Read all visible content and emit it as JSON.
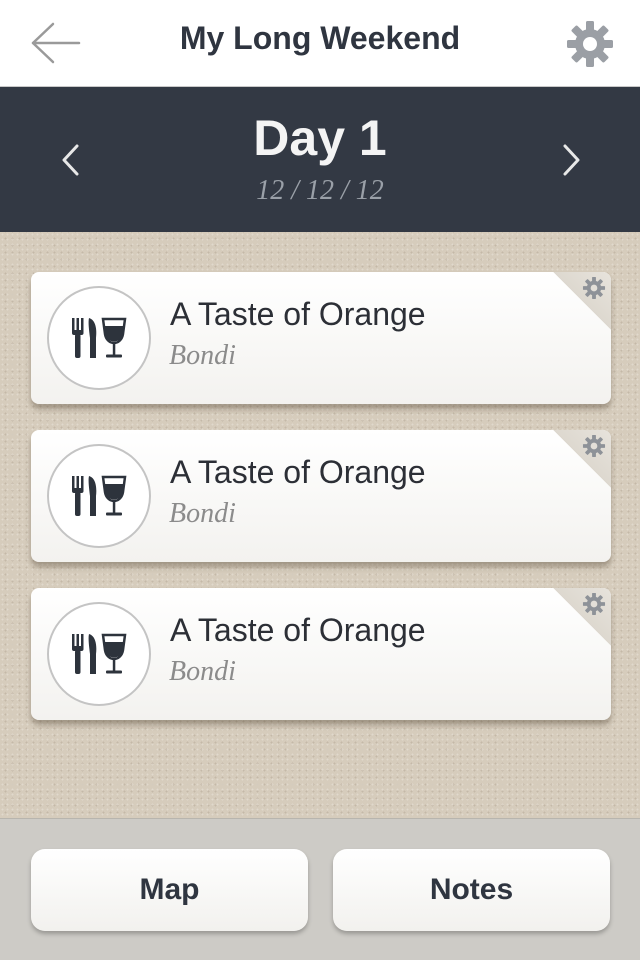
{
  "nav": {
    "back_icon": "arrow-left-icon",
    "title": "My Long Weekend",
    "settings_icon": "gear-icon"
  },
  "day": {
    "title": "Day 1",
    "date": "12 / 12 / 12",
    "prev_icon": "chevron-left-icon",
    "next_icon": "chevron-right-icon"
  },
  "items": [
    {
      "title": "A Taste of Orange",
      "location": "Bondi",
      "icon": "restaurant-icon",
      "menu_icon": "gear-icon"
    },
    {
      "title": "A Taste of Orange",
      "location": "Bondi",
      "icon": "restaurant-icon",
      "menu_icon": "gear-icon"
    },
    {
      "title": "A Taste of Orange",
      "location": "Bondi",
      "icon": "restaurant-icon",
      "menu_icon": "gear-icon"
    }
  ],
  "bottom": {
    "map_label": "Map",
    "notes_label": "Notes"
  },
  "colors": {
    "header_dark": "#333944",
    "text_dark": "#2f3540",
    "sand": "#d6ccbc"
  }
}
